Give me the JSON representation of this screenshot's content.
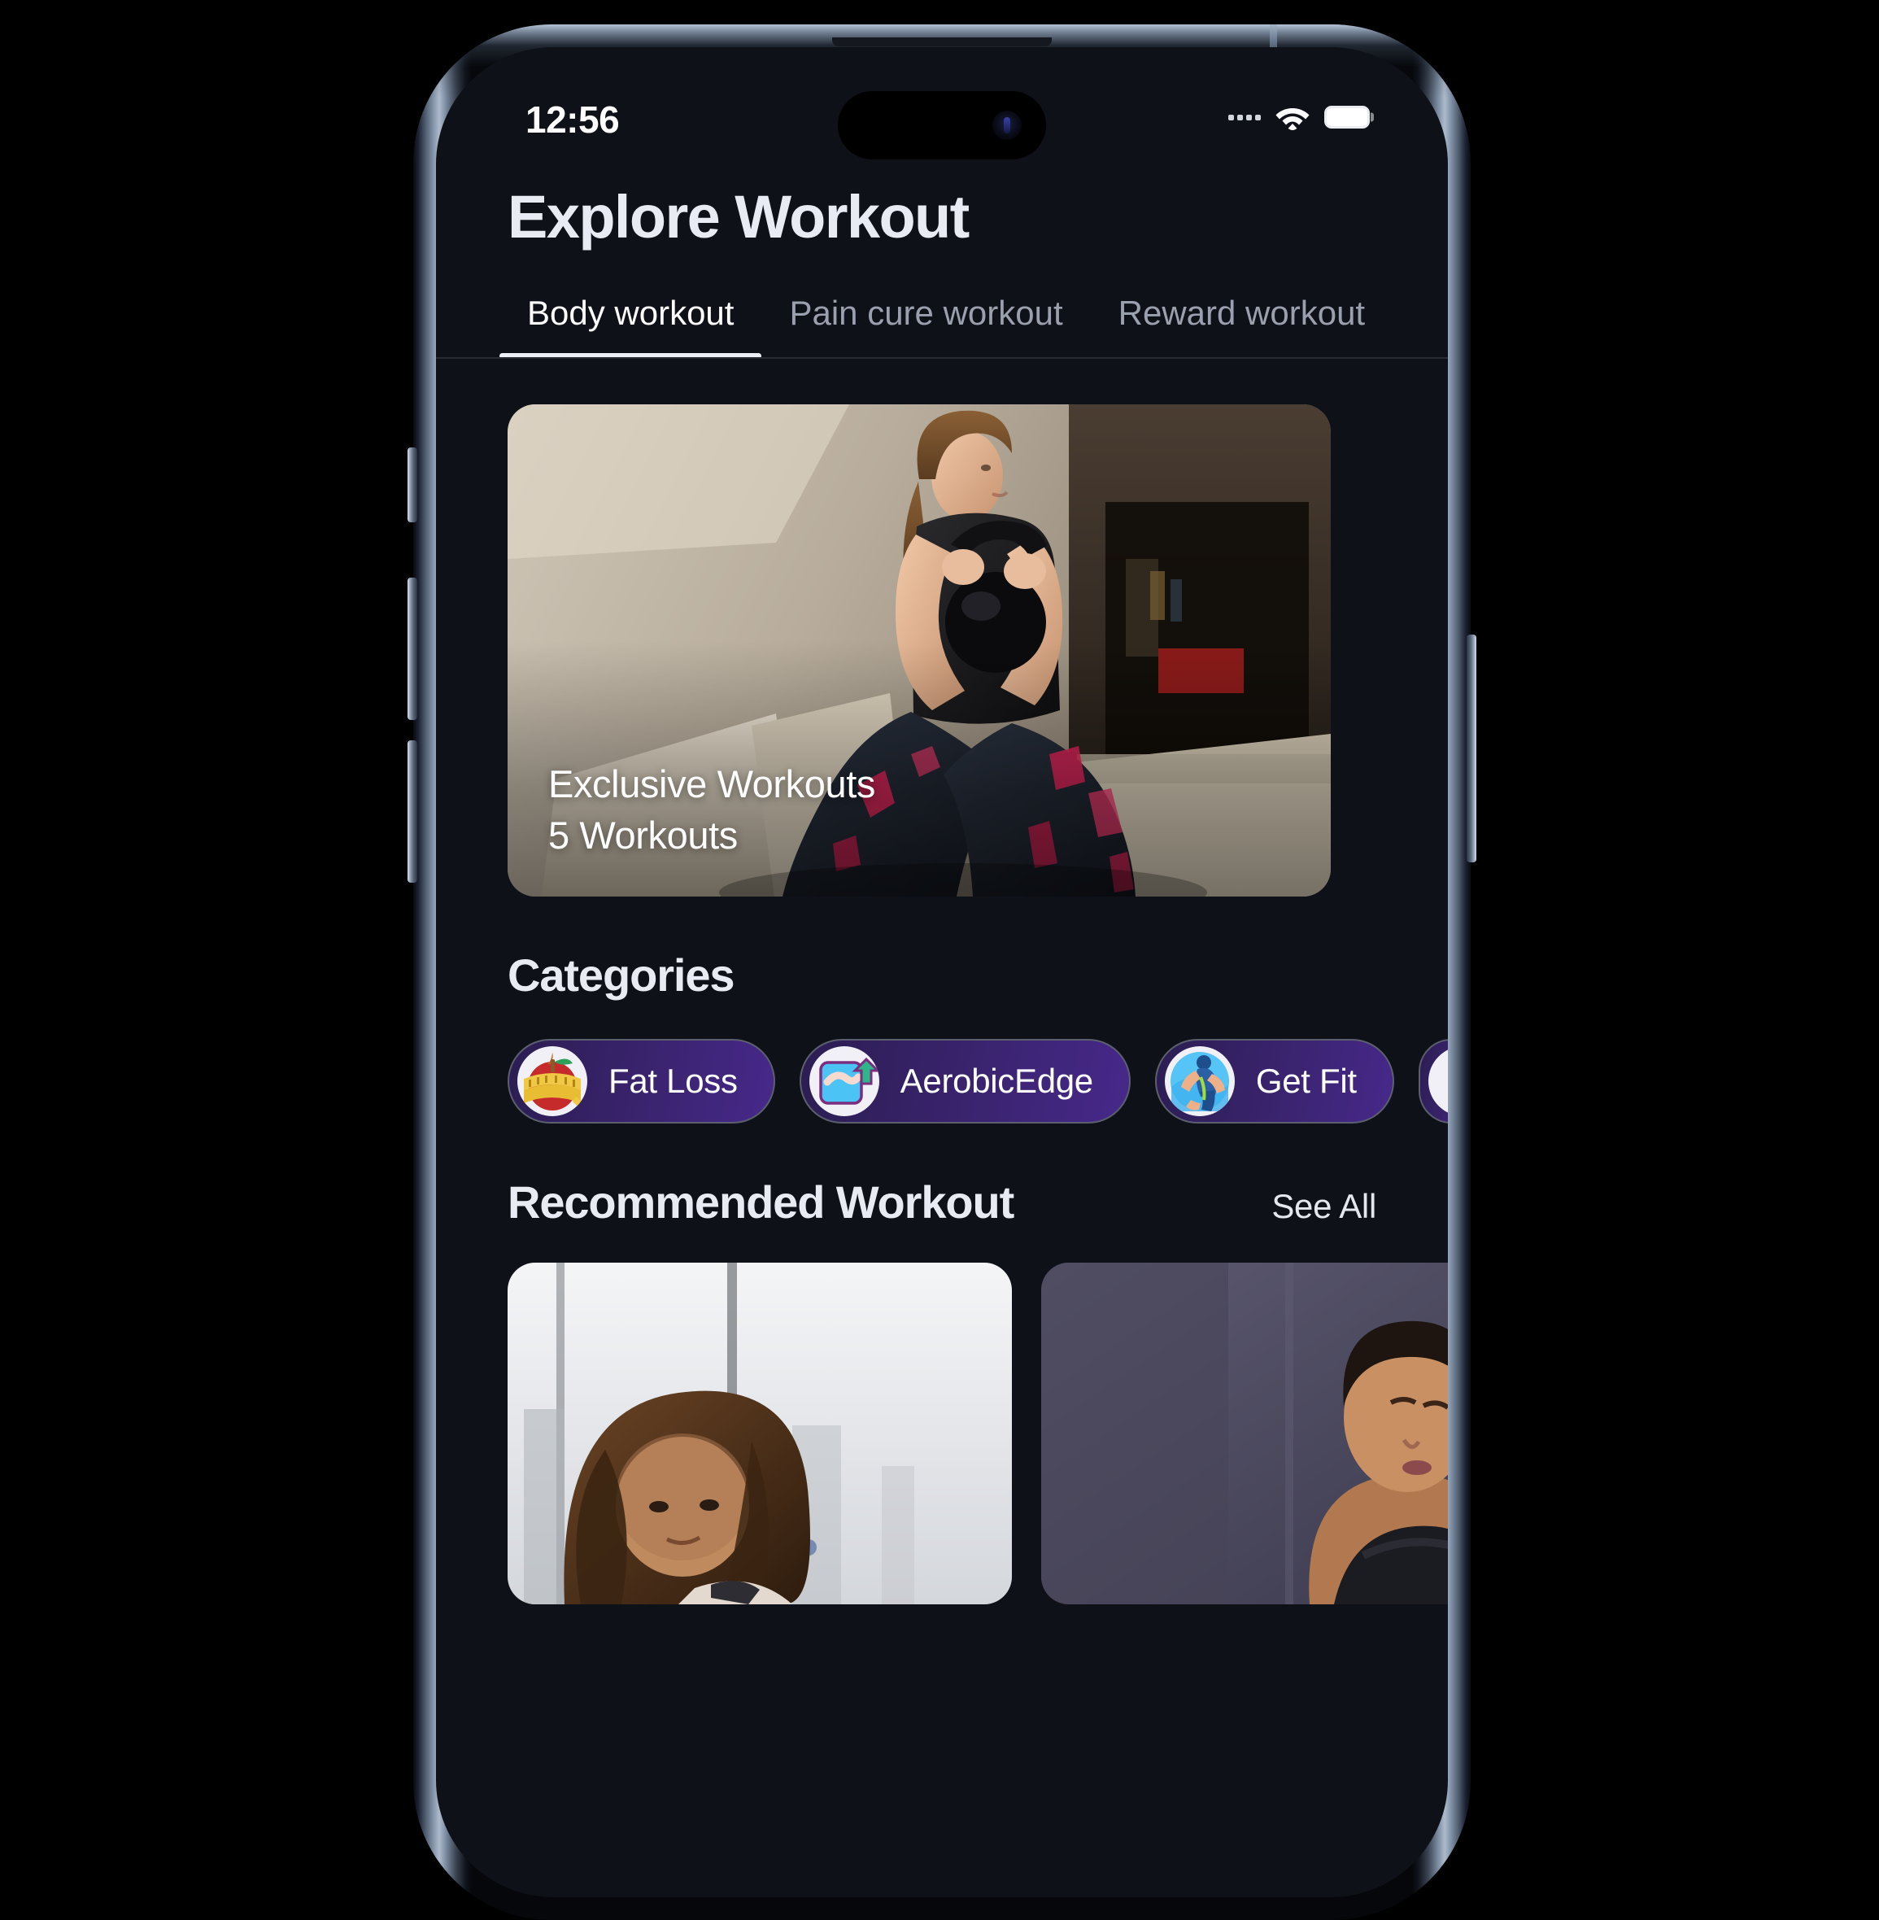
{
  "status_bar": {
    "time": "12:56",
    "cellular_icon": "cellular-dots-icon",
    "wifi_icon": "wifi-icon",
    "battery_icon": "battery-full-icon"
  },
  "header": {
    "title": "Explore Workout"
  },
  "tabs": [
    {
      "label": "Body workout",
      "active": true
    },
    {
      "label": "Pain cure workout",
      "active": false
    },
    {
      "label": "Reward workout",
      "active": false
    }
  ],
  "hero": {
    "title": "Exclusive Workouts",
    "subtitle": "5 Workouts",
    "image_alt": "woman doing kettlebell squat in living room"
  },
  "categories": {
    "heading": "Categories",
    "items": [
      {
        "label": "Fat Loss",
        "icon": "apple-measuring-tape-icon"
      },
      {
        "label": "AerobicEdge",
        "icon": "chart-up-arrow-icon"
      },
      {
        "label": "Get Fit",
        "icon": "running-person-icon"
      },
      {
        "label": "",
        "icon": "partial-chip-icon"
      }
    ]
  },
  "recommended": {
    "heading": "Recommended Workout",
    "see_all_label": "See All",
    "cards": [
      {
        "image_alt": "woman with curly hair outdoors"
      },
      {
        "image_alt": "woman in sports bra against dark wall"
      }
    ]
  },
  "colors": {
    "screen_background": "#0e1117",
    "accent_purple": "#46288a",
    "text_primary": "#e8eaf4",
    "text_muted": "#9aa0ad",
    "tab_underline": "#eef0f8"
  }
}
